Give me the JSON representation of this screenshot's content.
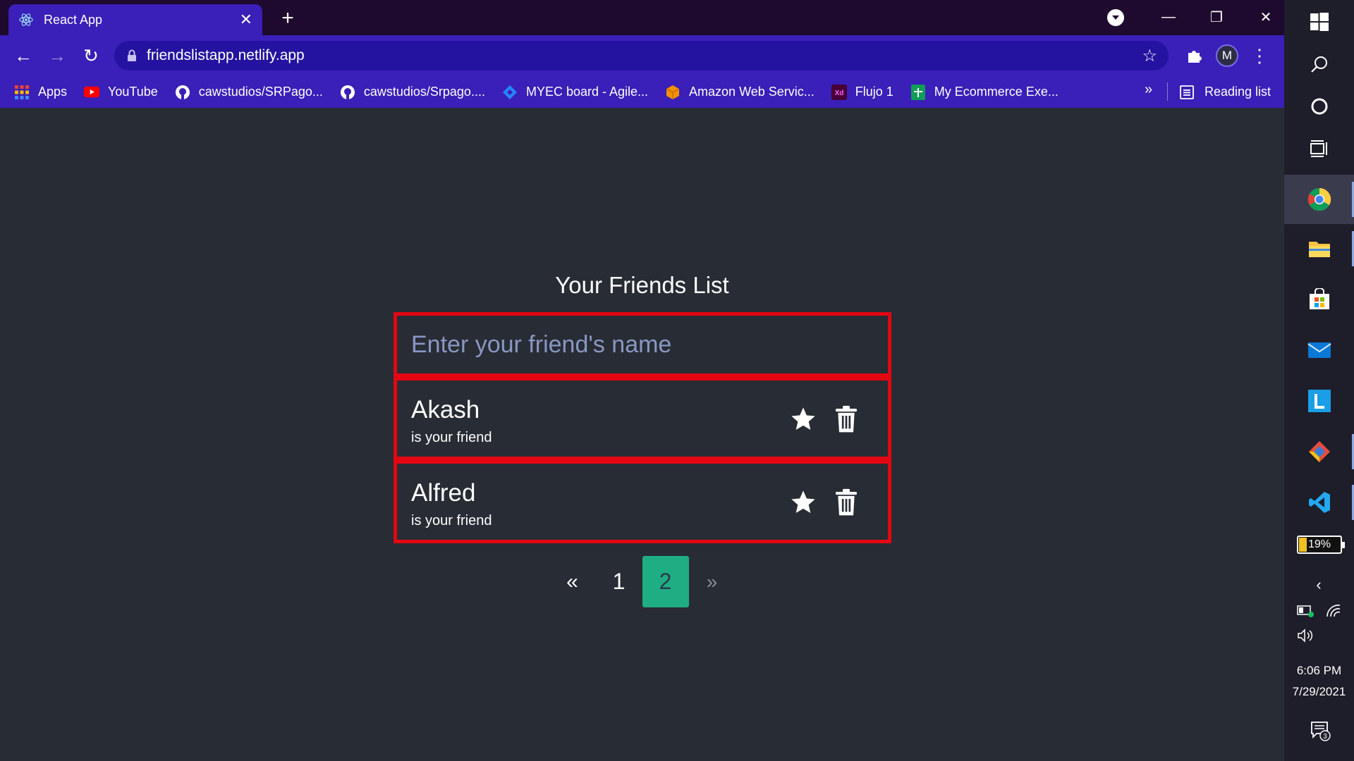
{
  "browser": {
    "tab_title": "React App",
    "url": "friendslistapp.netlify.app",
    "profile_initial": "M",
    "bookmarks": [
      {
        "label": "Apps",
        "icon": "apps-grid-icon"
      },
      {
        "label": "YouTube",
        "icon": "youtube-icon"
      },
      {
        "label": "cawstudios/SRPago...",
        "icon": "github-icon"
      },
      {
        "label": "cawstudios/Srpago....",
        "icon": "github-icon"
      },
      {
        "label": "MYEC board - Agile...",
        "icon": "jira-icon"
      },
      {
        "label": "Amazon Web Servic...",
        "icon": "aws-icon"
      },
      {
        "label": "Flujo 1",
        "icon": "adobe-xd-icon"
      },
      {
        "label": "My Ecommerce Exe...",
        "icon": "sheets-icon"
      }
    ],
    "more_label": "»",
    "reading_list_label": "Reading list"
  },
  "app": {
    "heading": "Your Friends List",
    "input_placeholder": "Enter your friend's name",
    "friends": [
      {
        "name": "Akash",
        "subtitle": "is your friend"
      },
      {
        "name": "Alfred",
        "subtitle": "is your friend"
      }
    ],
    "pagination": {
      "prev": "«",
      "pages": [
        "1",
        "2"
      ],
      "active_page": "2",
      "next": "»"
    },
    "colors": {
      "background": "#282c34",
      "highlight_border": "#e40613",
      "active_page": "#1fad84"
    }
  },
  "taskbar": {
    "battery_label": "19%",
    "battery_level": 0.19,
    "time": "6:06 PM",
    "date": "7/29/2021",
    "notification_count": "3"
  }
}
